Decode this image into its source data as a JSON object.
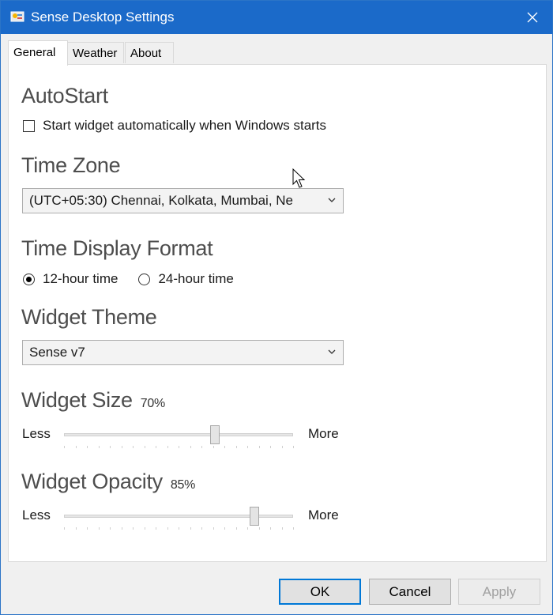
{
  "window": {
    "title": "Sense Desktop Settings",
    "app_icon": "sense-app-icon",
    "close_icon": "close-icon"
  },
  "tabs": [
    {
      "label": "General",
      "active": true
    },
    {
      "label": "Weather",
      "active": false
    },
    {
      "label": "About",
      "active": false
    }
  ],
  "autostart": {
    "heading": "AutoStart",
    "checkbox_label": "Start widget automatically when Windows starts",
    "checked": false
  },
  "time_zone": {
    "heading": "Time Zone",
    "selected": "(UTC+05:30) Chennai, Kolkata, Mumbai, Ne"
  },
  "time_format": {
    "heading": "Time Display Format",
    "options": [
      {
        "label": "12-hour time",
        "checked": true
      },
      {
        "label": "24-hour time",
        "checked": false
      }
    ]
  },
  "theme": {
    "heading": "Widget Theme",
    "selected": "Sense v7"
  },
  "size": {
    "heading": "Widget Size",
    "percent_label": "70%",
    "value": 0.66,
    "less": "Less",
    "more": "More"
  },
  "opacity": {
    "heading": "Widget Opacity",
    "percent_label": "85%",
    "value": 0.83,
    "less": "Less",
    "more": "More"
  },
  "buttons": {
    "ok": "OK",
    "cancel": "Cancel",
    "apply": "Apply"
  },
  "colors": {
    "titlebar": "#1b6ac9",
    "accent": "#0078d7"
  }
}
